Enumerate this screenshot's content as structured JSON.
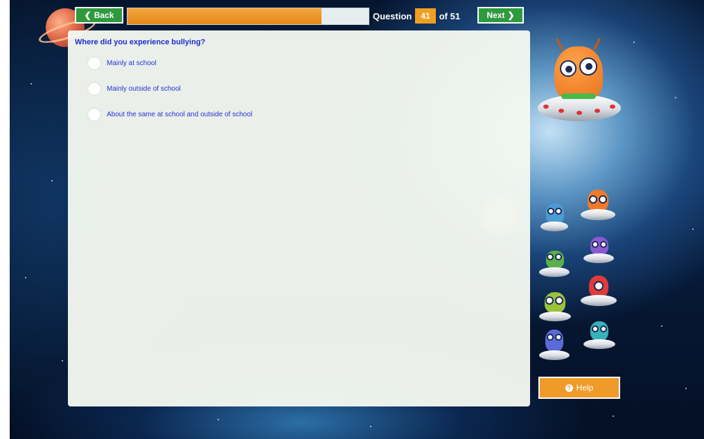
{
  "nav": {
    "back_label": "Back",
    "next_label": "Next",
    "back_icon": "chevron-left-icon",
    "next_icon": "chevron-right-icon"
  },
  "progress": {
    "value": 0.804
  },
  "counter": {
    "prefix": "Question",
    "current": "41",
    "suffix": "of 51"
  },
  "question": {
    "text": "Where did you experience bullying?",
    "options": [
      "Mainly at school",
      "Mainly outside of school",
      "About the same at school and outside of school"
    ]
  },
  "help": {
    "label": "Help",
    "icon": "question-circle-icon"
  },
  "colors": {
    "nav_green": "#2e9a3e",
    "progress_orange": "#e5891c",
    "question_blue": "#1a2ed0",
    "help_orange": "#f09a2a"
  }
}
